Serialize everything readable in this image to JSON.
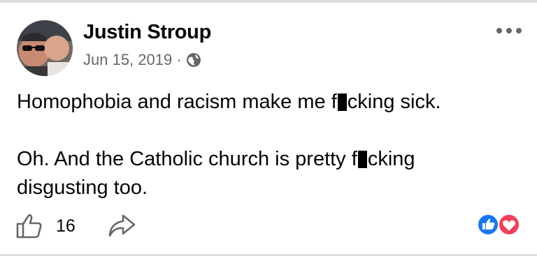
{
  "post": {
    "author": "Justin Stroup",
    "date": "Jun 15, 2019",
    "separator": "·",
    "privacy_icon": "globe-icon",
    "line1_a": "Homophobia and racism make me f",
    "line1_b": "cking sick.",
    "line2_a": "Oh. And the Catholic church is pretty f",
    "line2_b": "cking",
    "line3": "disgusting too.",
    "like_count": "16",
    "reactions": [
      "like-reaction-icon",
      "love-reaction-icon"
    ]
  },
  "colors": {
    "text": "#050505",
    "secondary": "#65676b",
    "like_blue": "#1877f2",
    "love_red": "#f33e58",
    "divider": "#dadde1"
  }
}
